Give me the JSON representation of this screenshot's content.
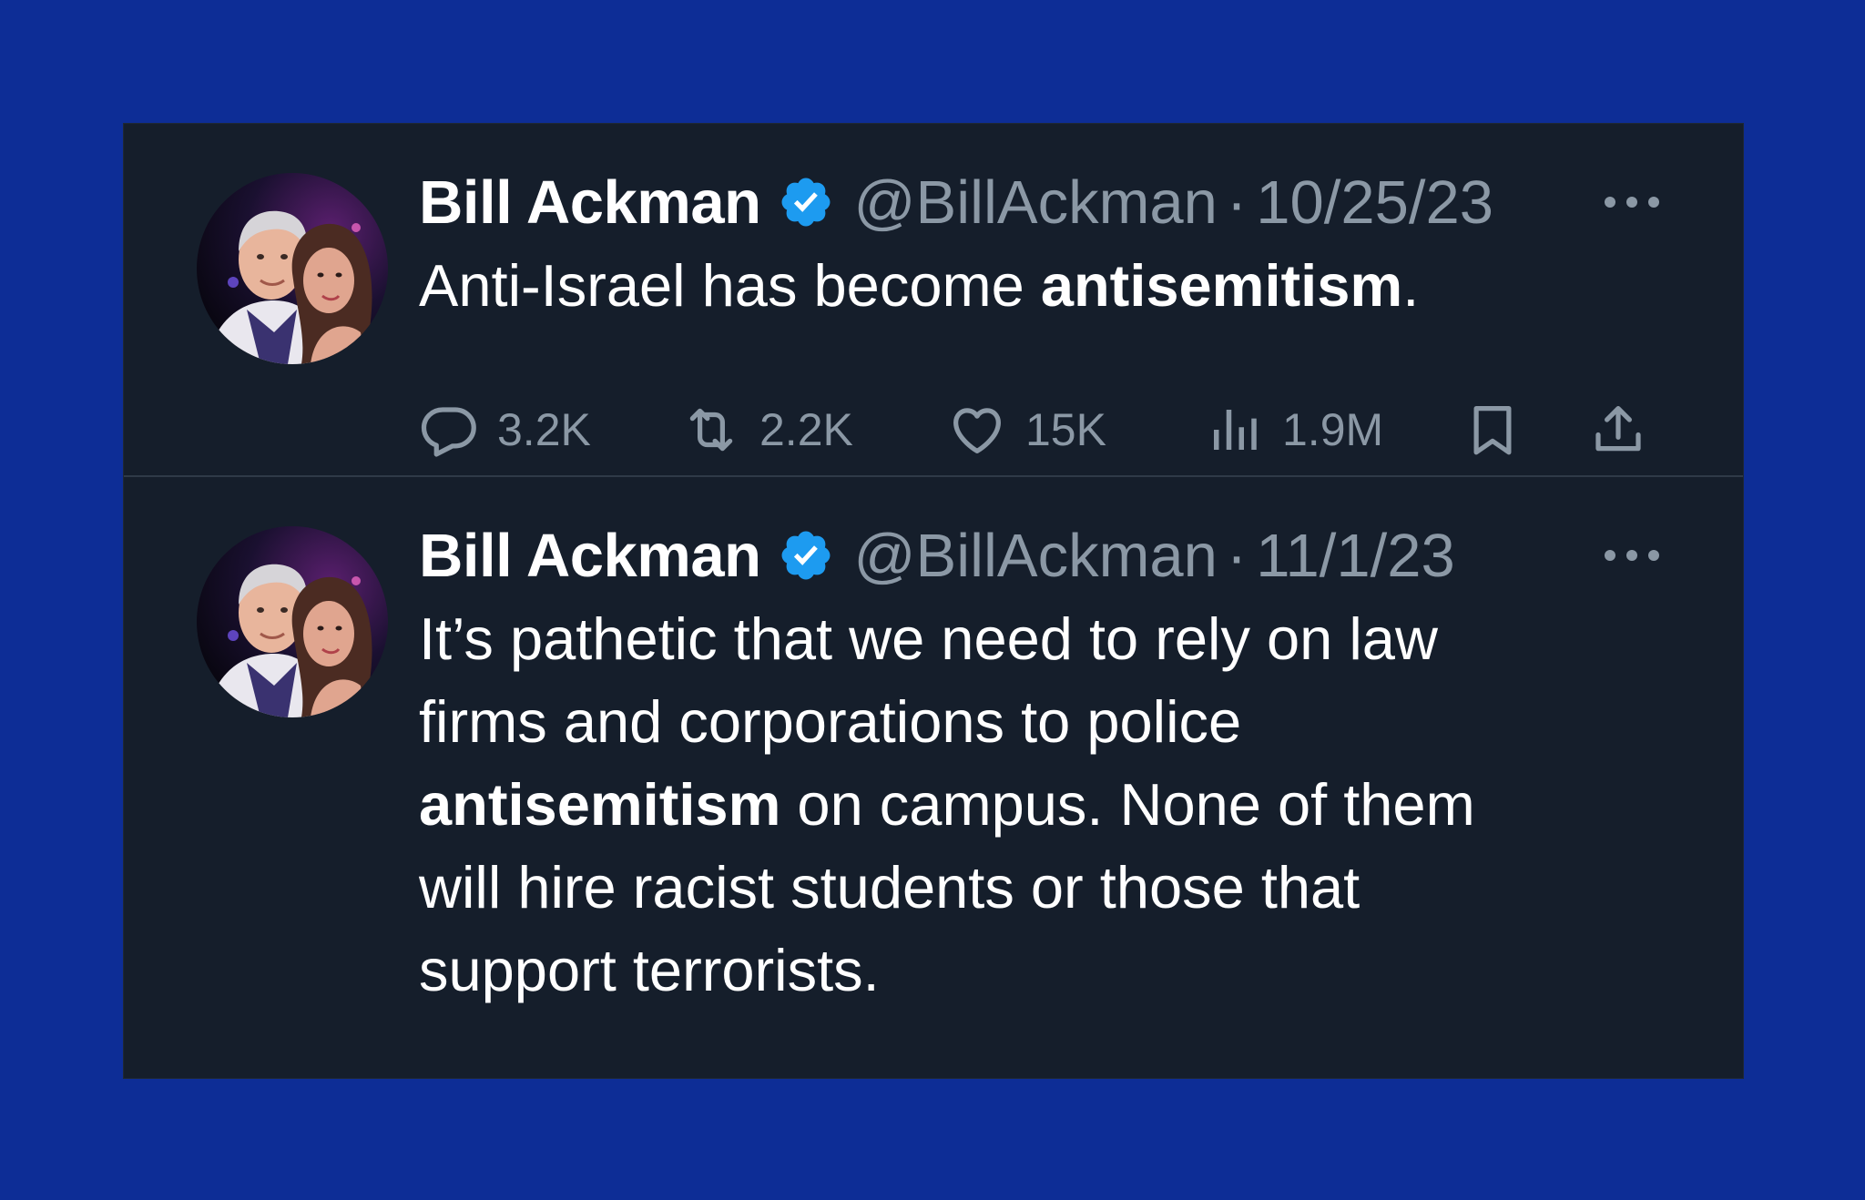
{
  "tweets": [
    {
      "author_name": "Bill Ackman",
      "verified_icon": "verified-badge-icon",
      "handle": "@BillAckman",
      "separator": "·",
      "date": "10/25/23",
      "text_parts": [
        "Anti-Israel has become ",
        "antisemitism",
        "."
      ],
      "stats": {
        "replies": "3.2K",
        "reposts": "2.2K",
        "likes": "15K",
        "views": "1.9M"
      }
    },
    {
      "author_name": "Bill Ackman",
      "verified_icon": "verified-badge-icon",
      "handle": "@BillAckman",
      "separator": "·",
      "date": "11/1/23",
      "text_lines": [
        "It’s pathetic that we need to rely on law",
        "firms and corporations to police",
        "antisemitism",
        " on campus. None of them",
        "will hire racist students or those that",
        "support terrorists."
      ]
    }
  ],
  "icons": {
    "more": "more-icon",
    "reply": "reply-icon",
    "repost": "repost-icon",
    "like": "heart-icon",
    "views": "views-chart-icon",
    "bookmark": "bookmark-icon",
    "share": "share-icon"
  },
  "colors": {
    "background": "#0d2d96",
    "card": "#151e2b",
    "divider": "#2f3a48",
    "primary_text": "#ffffff",
    "secondary_text": "#8b98a5",
    "verified": "#1d9bf0"
  }
}
